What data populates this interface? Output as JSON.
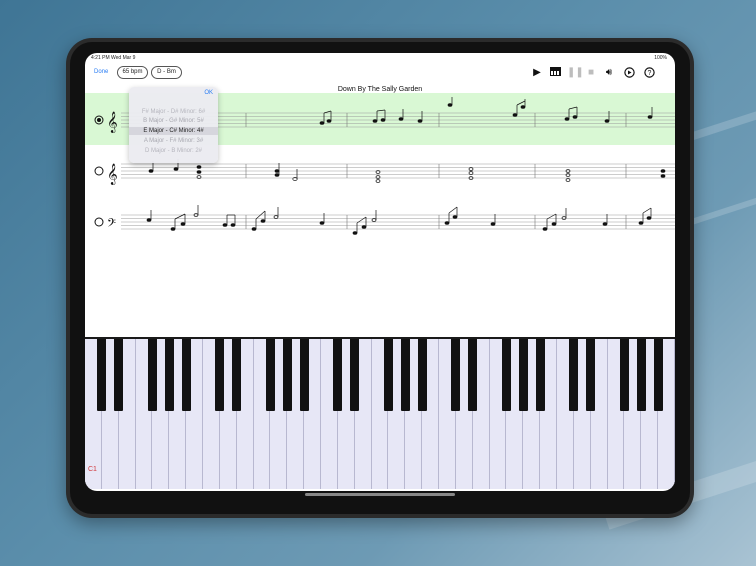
{
  "status_bar": {
    "time": "4:21 PM   Wed Mar 9",
    "battery": "100%"
  },
  "toolbar": {
    "done_label": "Done",
    "tempo": "65 bpm",
    "key": "D - Bm",
    "icons": [
      "play-icon",
      "piano-icon",
      "pause-icon",
      "stop-icon",
      "volume-icon",
      "replay-icon",
      "help-icon"
    ]
  },
  "score": {
    "title": "Down By The Sally Garden"
  },
  "key_dropdown": {
    "ok_label": "OK",
    "items": [
      {
        "label": "F# Major - D# Minor: 6#",
        "selected": false
      },
      {
        "label": "B Major - G# Minor: 5#",
        "selected": false
      },
      {
        "label": "E Major - C# Minor: 4#",
        "selected": true
      },
      {
        "label": "A Major - F# Minor: 3#",
        "selected": false
      },
      {
        "label": "D Major - B Minor: 2#",
        "selected": false
      }
    ]
  },
  "piano": {
    "start_label": "C1"
  },
  "colors": {
    "accent": "#2a7df4",
    "highlight": "#d9f8d4",
    "label_red": "#d1383c"
  }
}
